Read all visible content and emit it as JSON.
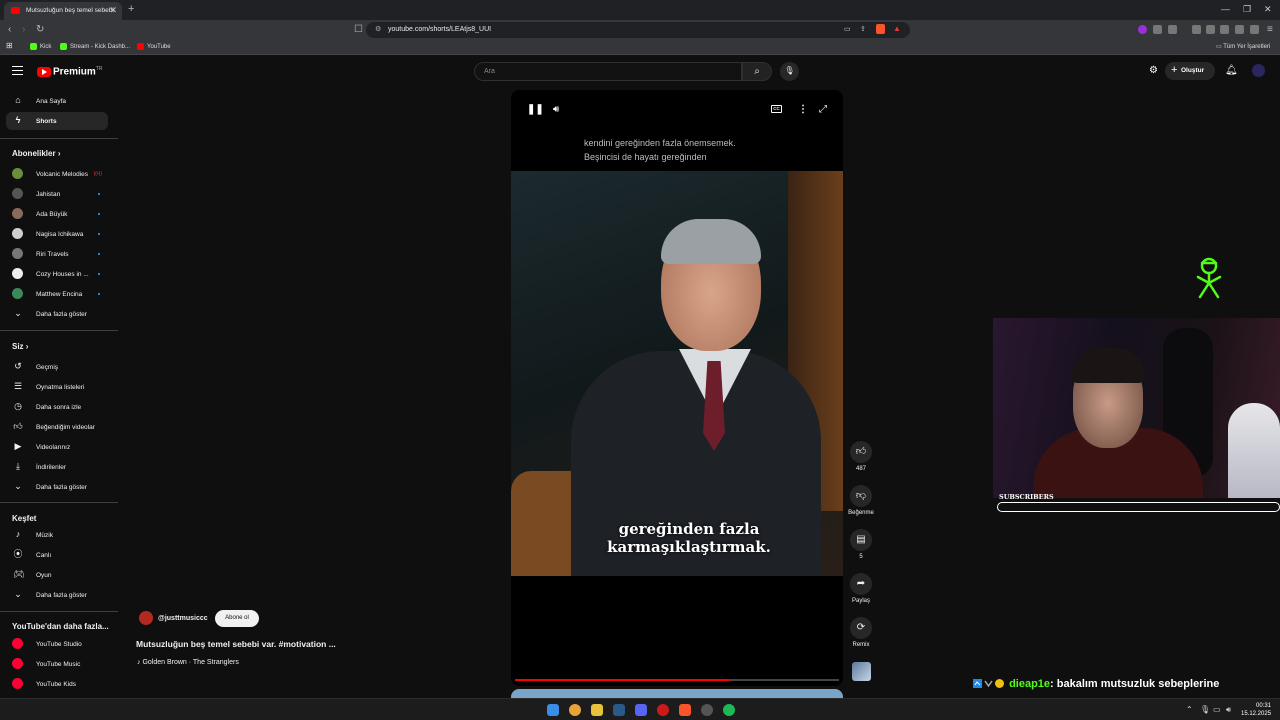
{
  "browser": {
    "tab_title": "Mutsuzluğun beş temel sebebi",
    "url": "youtube.com/shorts/LEAtjs8_UUI",
    "bookmarks": [
      "Kick",
      "Stream - Kick Dashb...",
      "YouTube"
    ],
    "bookmarks_right": "Tüm Yer İşaretleri"
  },
  "youtube": {
    "logo": "Premium",
    "logo_region": "TR",
    "search_placeholder": "Ara",
    "create_label": "Oluştur",
    "sidebar": {
      "main": [
        {
          "label": "Ana Sayfa",
          "icon": "home-icon"
        },
        {
          "label": "Shorts",
          "icon": "shorts-icon"
        }
      ],
      "subs_header": "Abonelikler",
      "subs": [
        {
          "label": "Volcanic Melodies",
          "color": "#6b8e3a",
          "live": true
        },
        {
          "label": "Jahistan",
          "color": "#555555"
        },
        {
          "label": "Ada Büyük",
          "color": "#8a6a5a"
        },
        {
          "label": "Nagisa Ichikawa",
          "color": "#cfcfcf"
        },
        {
          "label": "Riri Travels",
          "color": "#777777"
        },
        {
          "label": "Cozy Houses in ...",
          "color": "#eeeeee"
        },
        {
          "label": "Matthew Encina",
          "color": "#3a8a5a"
        }
      ],
      "subs_more": "Daha fazla göster",
      "you_header": "Siz",
      "you": [
        {
          "label": "Geçmiş",
          "icon": "history-icon"
        },
        {
          "label": "Oynatma listeleri",
          "icon": "playlist-icon"
        },
        {
          "label": "Daha sonra izle",
          "icon": "watch-later-icon"
        },
        {
          "label": "Beğendiğim videolar",
          "icon": "like-icon"
        },
        {
          "label": "Videolarınız",
          "icon": "your-videos-icon"
        },
        {
          "label": "İndirilenler",
          "icon": "download-icon"
        }
      ],
      "you_more": "Daha fazla göster",
      "explore_header": "Keşfet",
      "explore": [
        {
          "label": "Müzik",
          "icon": "music-icon"
        },
        {
          "label": "Canlı",
          "icon": "live-icon"
        },
        {
          "label": "Oyun",
          "icon": "gaming-icon"
        }
      ],
      "explore_more": "Daha fazla göster",
      "more_header": "YouTube'dan daha fazla...",
      "more": [
        {
          "label": "YouTube Studio"
        },
        {
          "label": "YouTube Music"
        },
        {
          "label": "YouTube Kids"
        }
      ]
    },
    "short": {
      "caption_top_1": "kendini gereğinden fazla önemsemek.",
      "caption_top_2": "Beşincisi de hayatı gereğinden",
      "subtitle_1": "gereğinden fazla",
      "subtitle_2": "karmaşıklaştırmak.",
      "progress": 0.66,
      "likes": "487",
      "dislike_label": "Beğenme",
      "comments": "5",
      "share_label": "Paylaş",
      "remix_label": "Remix",
      "channel": "@justtmusiccc",
      "subscribe_label": "Abone ol",
      "title": "Mutsuzluğun beş temel sebebi var. #motivation ...",
      "music": "Golden Brown · The Stranglers"
    }
  },
  "overlay": {
    "subscribers_label": "SUBSCRIBERS",
    "chat_user": "dieap1e",
    "chat_message": ": bakalım mutsuzluk sebeplerine",
    "kick_color": "#53fc18"
  },
  "taskbar": {
    "time": "00:31",
    "date": "15.12.2025"
  }
}
